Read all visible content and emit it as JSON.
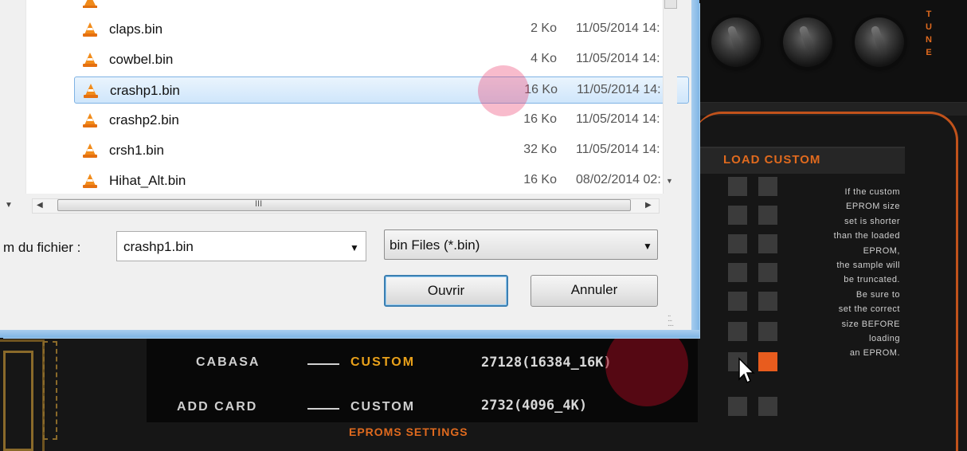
{
  "synth": {
    "tune_letters": [
      "T",
      "U",
      "N",
      "E"
    ],
    "load_custom": {
      "title": "LOAD CUSTOM",
      "info_lines": [
        "If the custom",
        "EPROM size",
        "set is shorter",
        "than the loaded",
        "EPROM,",
        "the sample will",
        "be truncated.",
        "Be sure to",
        "set the correct",
        "size BEFORE",
        "loading",
        "an EPROM."
      ]
    },
    "eprom_rows": [
      {
        "name": "CABASA",
        "mode": "CUSTOM",
        "size": "27128(16384_16K)",
        "mode_active": true
      },
      {
        "name": "ADD CARD",
        "mode": "CUSTOM",
        "size": "2732(4096_4K)",
        "mode_active": false
      }
    ],
    "eproms_settings_label": "EPROMS SETTINGS",
    "accent_color": "#e06a1e"
  },
  "dialog": {
    "files": [
      {
        "name": "claps.bin",
        "size": "2 Ko",
        "date": "11/05/2014 14:",
        "selected": false,
        "icon": "vlc-cone-icon"
      },
      {
        "name": "cowbel.bin",
        "size": "4 Ko",
        "date": "11/05/2014 14:",
        "selected": false,
        "icon": "vlc-cone-icon"
      },
      {
        "name": "crashp1.bin",
        "size": "16 Ko",
        "date": "11/05/2014 14:",
        "selected": true,
        "icon": "vlc-cone-icon"
      },
      {
        "name": "crashp2.bin",
        "size": "16 Ko",
        "date": "11/05/2014 14:",
        "selected": false,
        "icon": "vlc-cone-icon"
      },
      {
        "name": "crsh1.bin",
        "size": "32 Ko",
        "date": "11/05/2014 14:",
        "selected": false,
        "icon": "vlc-cone-icon"
      },
      {
        "name": "Hihat_Alt.bin",
        "size": "16 Ko",
        "date": "08/02/2014 02:",
        "selected": false,
        "icon": "vlc-cone-icon"
      }
    ],
    "filename_label": "m du fichier :",
    "filename_value": "crashp1.bin",
    "filter_value": "bin Files (*.bin)",
    "open_button": "Ouvrir",
    "cancel_button": "Annuler",
    "scrollbar_grip": "III"
  }
}
